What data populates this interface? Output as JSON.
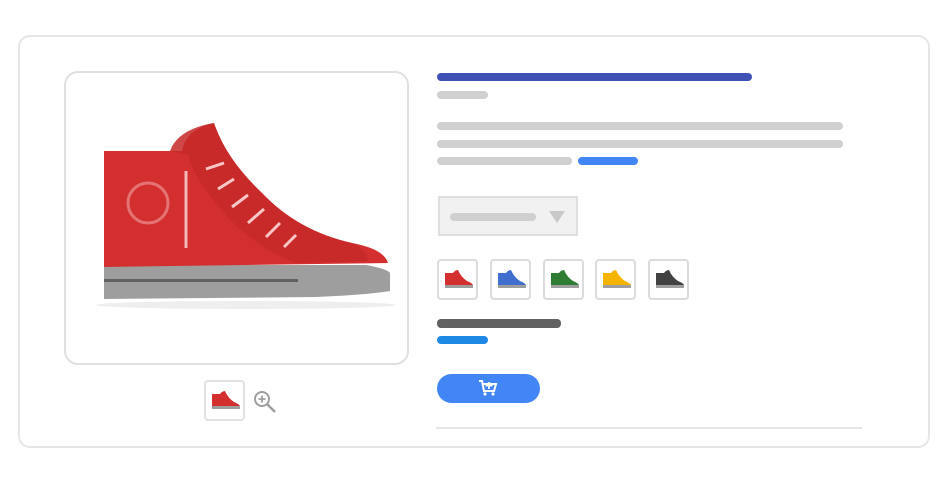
{
  "product": {
    "name_shown": "",
    "image_alt_icon": "high-top-sneaker-icon",
    "accent_color": "#3f51b5",
    "link_color": "#4285f4"
  },
  "colors": {
    "shoe_main": "#d32f2f",
    "shoe_sole": "#9e9e9e"
  },
  "swatches": [
    {
      "name": "red",
      "color": "#d32f2f"
    },
    {
      "name": "blue",
      "color": "#3f6ecf"
    },
    {
      "name": "green",
      "color": "#2e7d32"
    },
    {
      "name": "yellow",
      "color": "#f4b400"
    },
    {
      "name": "dark-gray",
      "color": "#424242"
    }
  ],
  "icons": {
    "zoom": "zoom-in-icon",
    "cart": "add-to-cart-icon",
    "dropdown": "chevron-down-icon"
  }
}
